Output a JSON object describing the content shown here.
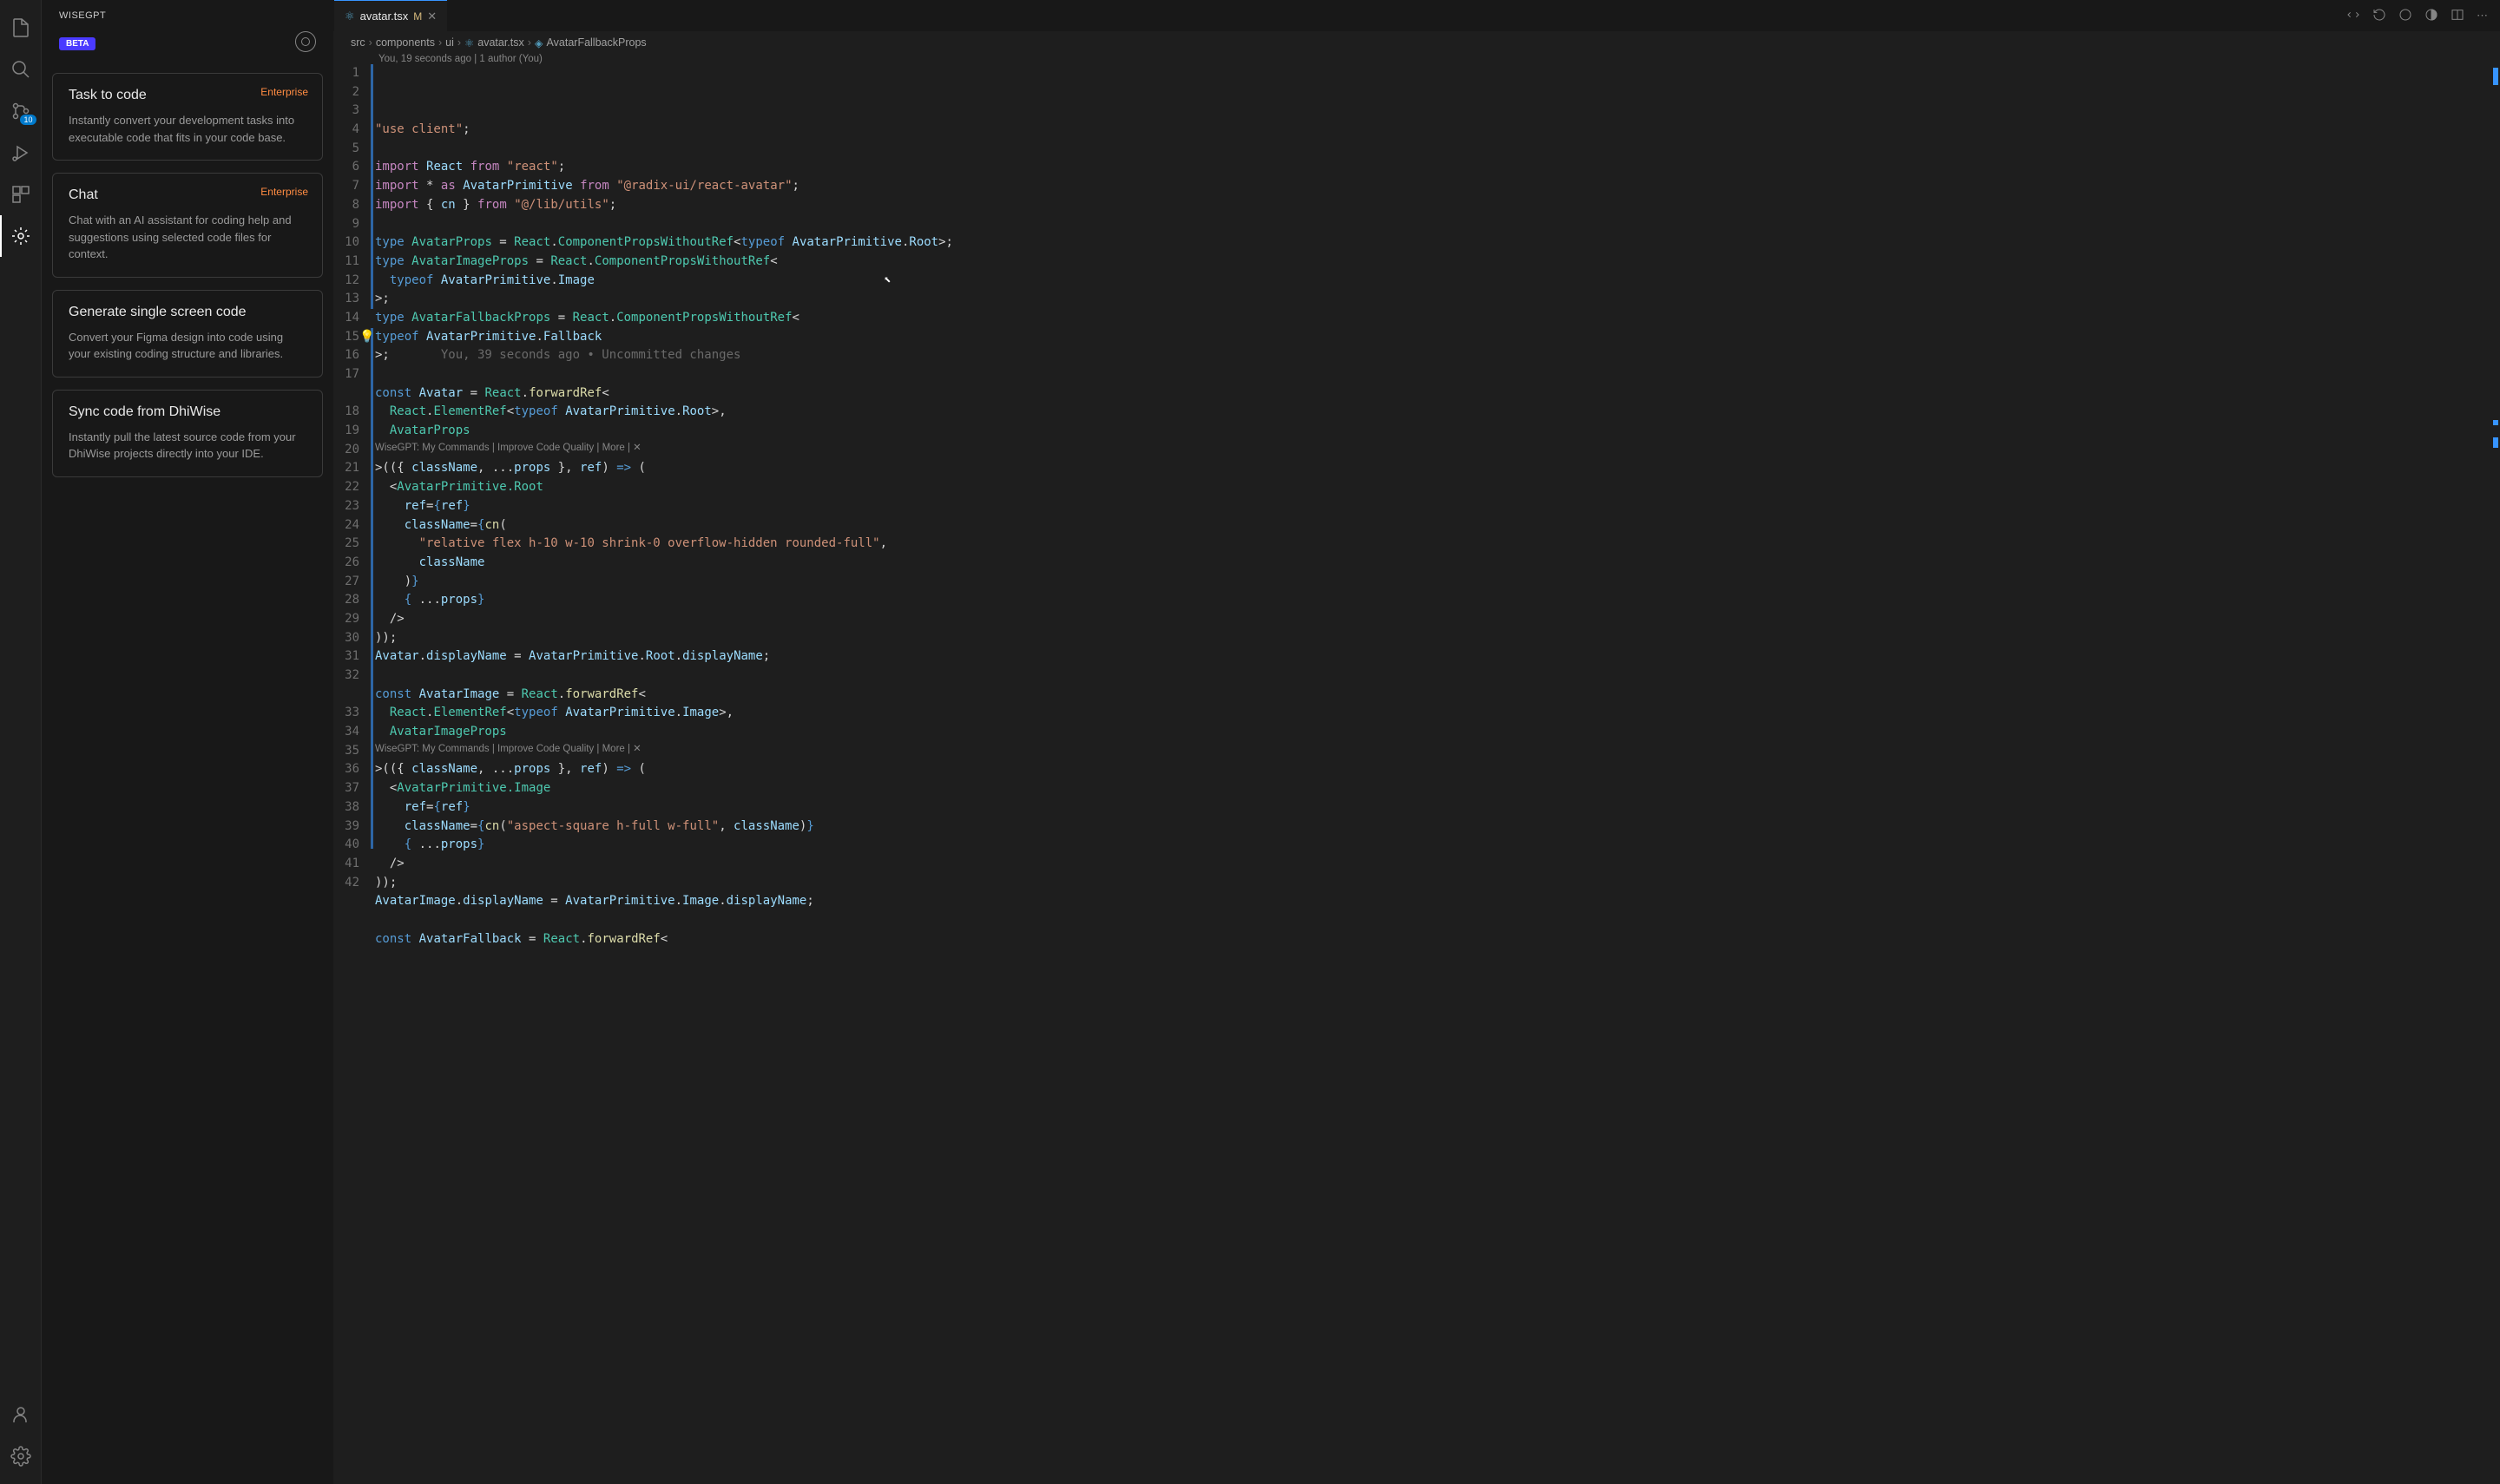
{
  "activity": {
    "badge": "10"
  },
  "sidebar": {
    "title": "WISEGPT",
    "beta": "BETA",
    "cards": [
      {
        "title": "Task to code",
        "desc": "Instantly convert your development tasks into executable code that fits in your code base.",
        "tag": "Enterprise"
      },
      {
        "title": "Chat",
        "desc": "Chat with an AI assistant for coding help and suggestions using selected code files for context.",
        "tag": "Enterprise"
      },
      {
        "title": "Generate single screen code",
        "desc": "Convert your Figma design into code using your existing coding structure and libraries.",
        "tag": ""
      },
      {
        "title": "Sync code from DhiWise",
        "desc": "Instantly pull the latest source code from your DhiWise projects directly into your IDE.",
        "tag": ""
      }
    ]
  },
  "tab": {
    "filename": "avatar.tsx",
    "modified": "M"
  },
  "breadcrumb": {
    "parts": [
      "src",
      "components",
      "ui",
      "avatar.tsx",
      "AvatarFallbackProps"
    ]
  },
  "codelens_top": "You, 19 seconds ago | 1 author (You)",
  "blame_inline": "You, 39 seconds ago • Uncommitted changes",
  "codelens_wise": "WiseGPT: My Commands | Improve Code Quality | More | ✕",
  "code": {
    "lines": [
      {
        "n": 1,
        "html": "<span class='tok-str'>\"use client\"</span>;"
      },
      {
        "n": 2,
        "html": ""
      },
      {
        "n": 3,
        "html": "<span class='tok-kw'>import</span> <span class='tok-var'>React</span> <span class='tok-kw'>from</span> <span class='tok-str'>\"react\"</span>;"
      },
      {
        "n": 4,
        "html": "<span class='tok-kw'>import</span> <span class='tok-op'>*</span> <span class='tok-kw'>as</span> <span class='tok-var'>AvatarPrimitive</span> <span class='tok-kw'>from</span> <span class='tok-str'>\"@radix-ui/react-avatar\"</span>;"
      },
      {
        "n": 5,
        "html": "<span class='tok-kw'>import</span> { <span class='tok-var'>cn</span> } <span class='tok-kw'>from</span> <span class='tok-str'>\"@/lib/utils\"</span>;"
      },
      {
        "n": 6,
        "html": ""
      },
      {
        "n": 7,
        "html": "<span class='tok-kw2'>type</span> <span class='tok-type'>AvatarProps</span> = <span class='tok-type'>React</span>.<span class='tok-type'>ComponentPropsWithoutRef</span>&lt;<span class='tok-kw2'>typeof</span> <span class='tok-var'>AvatarPrimitive</span>.<span class='tok-var'>Root</span>&gt;;"
      },
      {
        "n": 8,
        "html": "<span class='tok-kw2'>type</span> <span class='tok-type'>AvatarImageProps</span> = <span class='tok-type'>React</span>.<span class='tok-type'>ComponentPropsWithoutRef</span>&lt;"
      },
      {
        "n": 9,
        "html": "  <span class='tok-kw2'>typeof</span> <span class='tok-var'>AvatarPrimitive</span>.<span class='tok-var'>Image</span>"
      },
      {
        "n": 10,
        "html": "&gt;;"
      },
      {
        "n": 11,
        "html": "<span class='tok-kw2'>type</span> <span class='tok-type'>AvatarFallbackProps</span> = <span class='tok-type'>React</span>.<span class='tok-type'>ComponentPropsWithoutRef</span>&lt;"
      },
      {
        "n": 12,
        "html": "<span class='lightbulb'>💡</span><span class='tok-kw2'>typeof</span> <span class='tok-var'>AvatarPrimitive</span>.<span class='tok-var'>Fallback</span>"
      },
      {
        "n": 13,
        "html": "&gt;;       <span class='tok-comment' data-bind='blame_inline'></span>",
        "blame": true
      },
      {
        "n": 14,
        "html": ""
      },
      {
        "n": 15,
        "html": "<span class='tok-kw2'>const</span> <span class='tok-var'>Avatar</span> = <span class='tok-type'>React</span>.<span class='tok-fn'>forwardRef</span>&lt;"
      },
      {
        "n": 16,
        "html": "  <span class='tok-type'>React</span>.<span class='tok-type'>ElementRef</span>&lt;<span class='tok-kw2'>typeof</span> <span class='tok-var'>AvatarPrimitive</span>.<span class='tok-var'>Root</span>&gt;,"
      },
      {
        "n": 17,
        "html": "  <span class='tok-type'>AvatarProps</span>"
      },
      {
        "n": "lens1",
        "lens": true
      },
      {
        "n": 18,
        "html": "&gt;(({ <span class='tok-var'>className</span>, ...<span class='tok-var'>props</span> }, <span class='tok-var'>ref</span>) <span class='tok-kw2'>=&gt;</span> ("
      },
      {
        "n": 19,
        "html": "  &lt;<span class='tok-type'>AvatarPrimitive.Root</span>"
      },
      {
        "n": 20,
        "html": "    <span class='tok-var'>ref</span>=<span class='tok-kw2'>{</span><span class='tok-var'>ref</span><span class='tok-kw2'>}</span>"
      },
      {
        "n": 21,
        "html": "    <span class='tok-var'>className</span>=<span class='tok-kw2'>{</span><span class='tok-fn'>cn</span>("
      },
      {
        "n": 22,
        "html": "      <span class='tok-str'>\"relative flex h-10 w-10 shrink-0 overflow-hidden rounded-full\"</span>,"
      },
      {
        "n": 23,
        "html": "      <span class='tok-var'>className</span>"
      },
      {
        "n": 24,
        "html": "    )<span class='tok-kw2'>}</span>"
      },
      {
        "n": 25,
        "html": "    <span class='tok-kw2'>{</span> ...<span class='tok-var'>props</span><span class='tok-kw2'>}</span>"
      },
      {
        "n": 26,
        "html": "  /&gt;"
      },
      {
        "n": 27,
        "html": "));"
      },
      {
        "n": 28,
        "html": "<span class='tok-var'>Avatar</span>.<span class='tok-var'>displayName</span> = <span class='tok-var'>AvatarPrimitive</span>.<span class='tok-var'>Root</span>.<span class='tok-var'>displayName</span>;"
      },
      {
        "n": 29,
        "html": ""
      },
      {
        "n": 30,
        "html": "<span class='tok-kw2'>const</span> <span class='tok-var'>AvatarImage</span> = <span class='tok-type'>React</span>.<span class='tok-fn'>forwardRef</span>&lt;"
      },
      {
        "n": 31,
        "html": "  <span class='tok-type'>React</span>.<span class='tok-type'>ElementRef</span>&lt;<span class='tok-kw2'>typeof</span> <span class='tok-var'>AvatarPrimitive</span>.<span class='tok-var'>Image</span>&gt;,"
      },
      {
        "n": 32,
        "html": "  <span class='tok-type'>AvatarImageProps</span>"
      },
      {
        "n": "lens2",
        "lens": true
      },
      {
        "n": 33,
        "html": "&gt;(({ <span class='tok-var'>className</span>, ...<span class='tok-var'>props</span> }, <span class='tok-var'>ref</span>) <span class='tok-kw2'>=&gt;</span> ("
      },
      {
        "n": 34,
        "html": "  &lt;<span class='tok-type'>AvatarPrimitive.Image</span>"
      },
      {
        "n": 35,
        "html": "    <span class='tok-var'>ref</span>=<span class='tok-kw2'>{</span><span class='tok-var'>ref</span><span class='tok-kw2'>}</span>"
      },
      {
        "n": 36,
        "html": "    <span class='tok-var'>className</span>=<span class='tok-kw2'>{</span><span class='tok-fn'>cn</span>(<span class='tok-str'>\"aspect-square h-full w-full\"</span>, <span class='tok-var'>className</span>)<span class='tok-kw2'>}</span>"
      },
      {
        "n": 37,
        "html": "    <span class='tok-kw2'>{</span> ...<span class='tok-var'>props</span><span class='tok-kw2'>}</span>"
      },
      {
        "n": 38,
        "html": "  /&gt;"
      },
      {
        "n": 39,
        "html": "));"
      },
      {
        "n": 40,
        "html": "<span class='tok-var'>AvatarImage</span>.<span class='tok-var'>displayName</span> = <span class='tok-var'>AvatarPrimitive</span>.<span class='tok-var'>Image</span>.<span class='tok-var'>displayName</span>;"
      },
      {
        "n": 41,
        "html": ""
      },
      {
        "n": 42,
        "html": "<span class='tok-kw2'>const</span> <span class='tok-var'>AvatarFallback</span> = <span class='tok-type'>React</span>.<span class='tok-fn'>forwardRef</span>&lt;"
      }
    ]
  }
}
